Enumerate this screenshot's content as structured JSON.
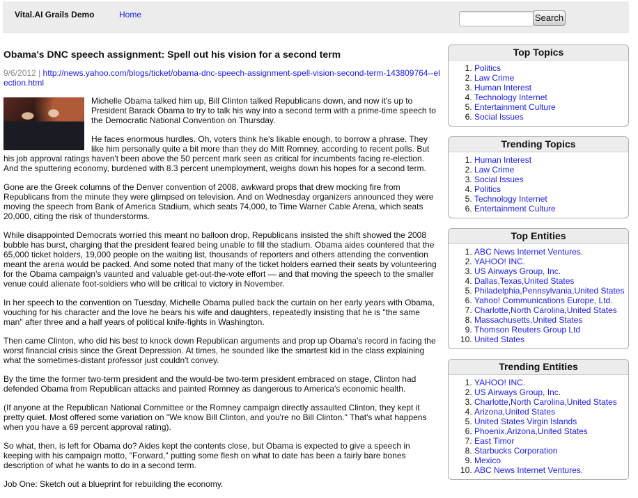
{
  "header": {
    "brand": "Vital.AI Grails Demo",
    "home_link": "Home",
    "search_placeholder": "",
    "search_button": "Search"
  },
  "article": {
    "title": "Obama's DNC speech assignment: Spell out his vision for a second term",
    "date": "9/6/2012",
    "separator": "|",
    "url": "http://news.yahoo.com/blogs/ticket/obama-dnc-speech-assignment-spell-vision-second-term-143809764--election.html",
    "paragraphs": [
      "Michelle Obama talked him up, Bill Clinton talked Republicans down, and now it's up to President Barack Obama to try to talk his way into a second term with a prime-time speech to the Democratic National Convention on Thursday.",
      "He faces enormous hurdles. Oh, voters think he's likable enough, to borrow a phrase. They like him personally quite a bit more than they do Mitt Romney, according to recent polls. But his job approval ratings haven't been above the 50 percent mark seen as critical for incumbents facing re-election. And the sputtering economy, burdened with 8.3 percent unemployment, weighs down his hopes for a second term.",
      "Gone are the Greek columns of the Denver convention of 2008, awkward props that drew mocking fire from Republicans from the minute they were glimpsed on television. And on Wednesday organizers announced they were moving the speech from Bank of America Stadium, which seats 74,000, to Time Warner Cable Arena, which seats 20,000, citing the risk of thunderstorms.",
      "While disappointed Democrats worried this meant no balloon drop, Republicans insisted the shift showed the 2008 bubble has burst, charging that the president feared being unable to fill the stadium. Obama aides countered that the 65,000 ticket holders, 19,000 people on the waiting list, thousands of reporters and others attending the convention meant the arena would be packed. And some noted that many of the ticket holders earned their seats by volunteering for the Obama campaign's vaunted and valuable get-out-the-vote effort — and that moving the speech to the smaller venue could alienate foot-soldiers who will be critical to victory in November.",
      "In her speech to the convention on Tuesday, Michelle Obama pulled back the curtain on her early years with Obama, vouching for his character and the love he bears his wife and daughters, repeatedly insisting that he is \"the same man\" after three and a half years of political knife-fights in Washington.",
      "Then came Clinton, who did his best to knock down Republican arguments and prop up Obama's record in facing the worst financial crisis since the Great Depression. At times, he sounded like the smartest kid in the class explaining what the sometimes-distant professor just couldn't convey.",
      "By the time the former two-term president and the would-be two-term president embraced on stage, Clinton had defended Obama from Republican attacks and painted Romney as dangerous to America's economic health.",
      "(If anyone at the Republican National Committee or the Romney campaign directly assaulted Clinton, they kept it pretty quiet. Most offered some variation on \"We know Bill Clinton, and you're no Bill Clinton.\" That's what happens when you have a 69 percent approval rating).",
      "So what, then, is left for Obama do? Aides kept the contents close, but Obama is expected to give a speech in keeping with his campaign motto, \"Forward,\" putting some flesh on what to date has been a fairly bare bones description of what he wants to do in a second term.",
      "Job One: Sketch out a blueprint for rebuilding the economy."
    ]
  },
  "sidebar": {
    "top_topics": {
      "title": "Top Topics",
      "items": [
        "Politics",
        "Law Crime",
        "Human Interest",
        "Technology Internet",
        "Entertainment Culture",
        "Social Issues"
      ]
    },
    "trending_topics": {
      "title": "Trending Topics",
      "items": [
        "Human Interest",
        "Law Crime",
        "Social Issues",
        "Politics",
        "Technology Internet",
        "Entertainment Culture"
      ]
    },
    "top_entities": {
      "title": "Top Entities",
      "items": [
        "ABC News Internet Ventures.",
        "YAHOO! INC.",
        "US Airways Group, Inc.",
        "Dallas,Texas,United States",
        "Philadelphia,Pennsylvania,United States",
        "Yahoo! Communications Europe, Ltd.",
        "Charlotte,North Carolina,United States",
        "Massachusetts,United States",
        "Thomson Reuters Group Ltd",
        "United States"
      ]
    },
    "trending_entities": {
      "title": "Trending Entities",
      "items": [
        "YAHOO! INC.",
        "US Airways Group, Inc.",
        "Charlotte,North Carolina,United States",
        "Arizona,United States",
        "United States Virgin Islands",
        "Phoenix,Arizona,United States",
        "East Timor",
        "Starbucks Corporation",
        "Mexico",
        "ABC News Internet Ventures."
      ]
    }
  }
}
